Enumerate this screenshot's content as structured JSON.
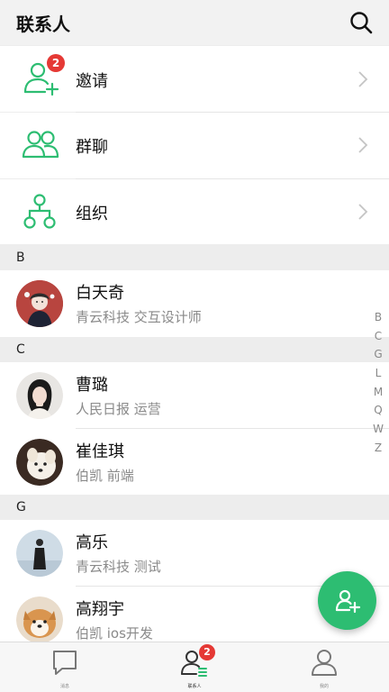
{
  "header": {
    "title": "联系人",
    "search_icon": "search-icon"
  },
  "actions": [
    {
      "label": "邀请",
      "icon": "add-person-icon",
      "badge": "2"
    },
    {
      "label": "群聊",
      "icon": "group-icon"
    },
    {
      "label": "组织",
      "icon": "org-tree-icon"
    }
  ],
  "sections": {
    "b": "B",
    "c": "C",
    "g": "G"
  },
  "contacts": [
    {
      "name": "白天奇",
      "sub": "青云科技 交互设计师"
    },
    {
      "name": "曹璐",
      "sub": "人民日报 运营"
    },
    {
      "name": "崔佳琪",
      "sub": "伯凯 前端"
    },
    {
      "name": "高乐",
      "sub": "青云科技 测试"
    },
    {
      "name": "高翔宇",
      "sub": "伯凯 ios开发"
    }
  ],
  "index_letters": [
    "B",
    "C",
    "G",
    "L",
    "M",
    "Q",
    "W",
    "Z"
  ],
  "tabs": [
    {
      "label": "消息",
      "icon": "chat-bubble-icon"
    },
    {
      "label": "联系人",
      "icon": "contacts-icon",
      "badge": "2"
    },
    {
      "label": "我的",
      "icon": "profile-icon"
    }
  ],
  "colors": {
    "accent": "#2dbd72",
    "badge": "#e53935"
  }
}
